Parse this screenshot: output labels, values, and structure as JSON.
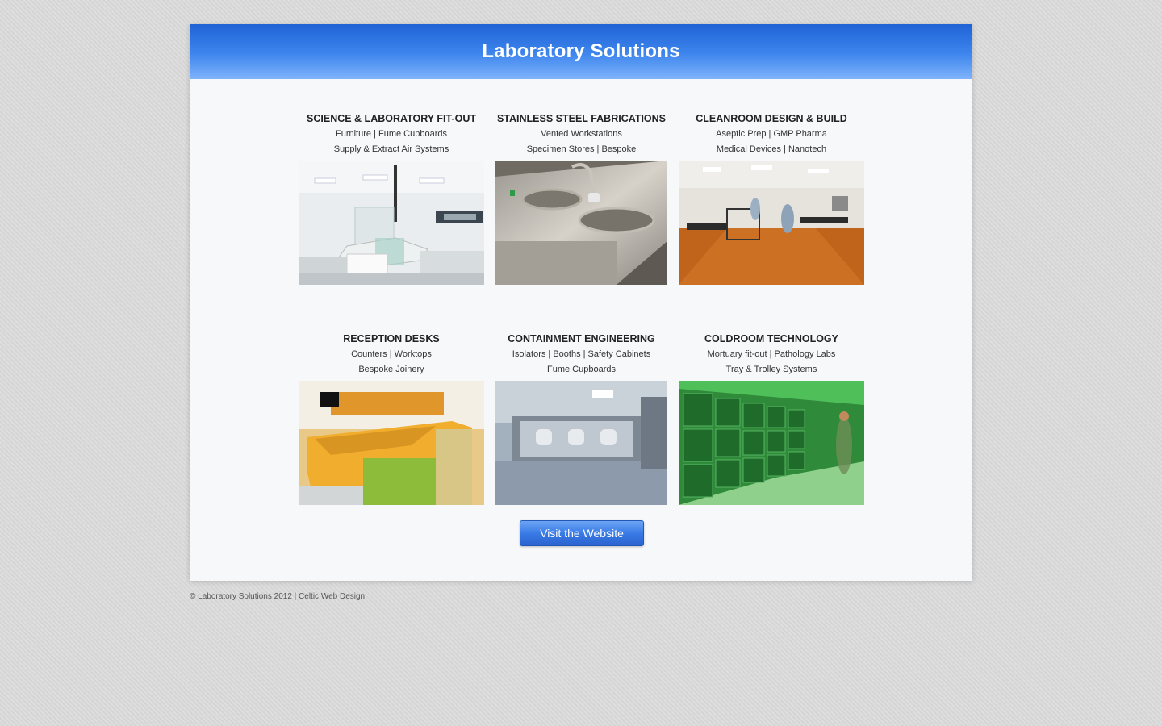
{
  "header": {
    "title": "Laboratory Solutions"
  },
  "tiles": [
    {
      "title": "SCIENCE & LABORATORY FIT-OUT",
      "line1": "Furniture | Fume Cupboards",
      "line2": "Supply & Extract Air Systems"
    },
    {
      "title": "STAINLESS STEEL FABRICATIONS",
      "line1": "Vented Workstations",
      "line2": "Specimen Stores | Bespoke"
    },
    {
      "title": "CLEANROOM DESIGN & BUILD",
      "line1": "Aseptic Prep | GMP Pharma",
      "line2": "Medical Devices | Nanotech"
    },
    {
      "title": "RECEPTION DESKS",
      "line1": "Counters | Worktops",
      "line2": "Bespoke Joinery"
    },
    {
      "title": "CONTAINMENT ENGINEERING",
      "line1": "Isolators | Booths | Safety Cabinets",
      "line2": "Fume Cupboards"
    },
    {
      "title": "COLDROOM TECHNOLOGY",
      "line1": "Mortuary fit-out | Pathology Labs",
      "line2": "Tray & Trolley Systems"
    }
  ],
  "cta": {
    "label": "Visit the Website"
  },
  "footer": {
    "text": "© Laboratory Solutions 2012 | Celtic Web Design"
  },
  "colors": {
    "header_top": "#1f63d6",
    "header_bottom": "#7fb3fb",
    "button": "#3a7be6"
  }
}
